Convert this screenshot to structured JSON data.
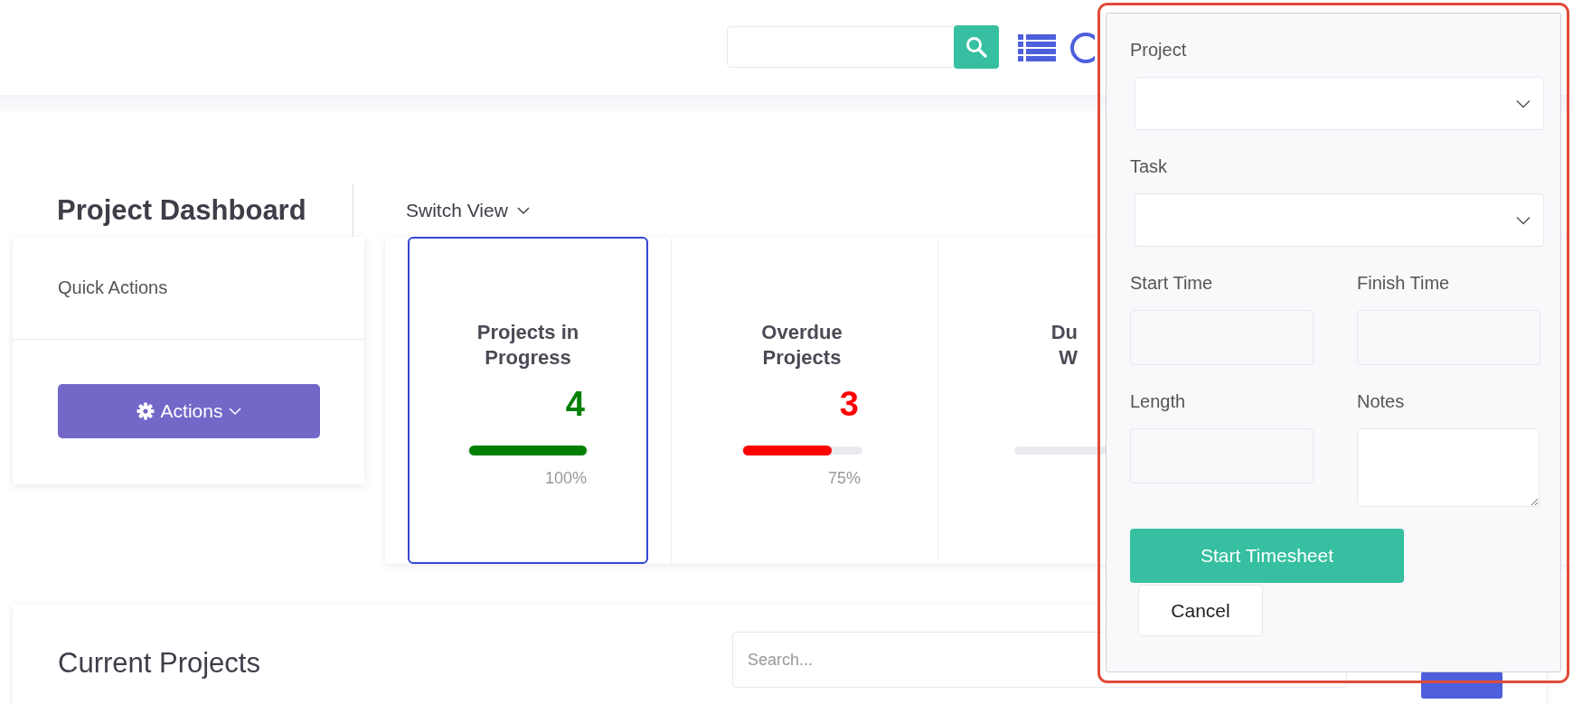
{
  "page": {
    "title": "Project Dashboard",
    "switch_view": "Switch View"
  },
  "quick_actions": {
    "title": "Quick Actions",
    "button": "Actions"
  },
  "stat_cards": [
    {
      "title_lines": [
        "Projects in",
        "Progress"
      ],
      "value": "4",
      "color": "#008000",
      "level": 1.0,
      "percent": "100%",
      "selected": true
    },
    {
      "title_lines": [
        "Overdue",
        "Projects"
      ],
      "value": "3",
      "color": "#ff0000",
      "level": 0.75,
      "percent": "75%",
      "selected": false
    },
    {
      "title_lines": [
        "Du",
        "W"
      ],
      "selected": false
    }
  ],
  "current_projects": {
    "title": "Current Projects",
    "search_placeholder": "Search..."
  },
  "timesheet_panel": {
    "fields": [
      {
        "kind": "select",
        "label": "Project"
      },
      {
        "kind": "select",
        "label": "Task"
      },
      {
        "kind": "input",
        "label": "Start Time"
      },
      {
        "kind": "input",
        "label": "Finish Time"
      },
      {
        "kind": "input",
        "label": "Length"
      },
      {
        "kind": "textarea",
        "label": "Notes"
      }
    ],
    "primary_button": "Start Timesheet",
    "cancel_button": "Cancel"
  }
}
